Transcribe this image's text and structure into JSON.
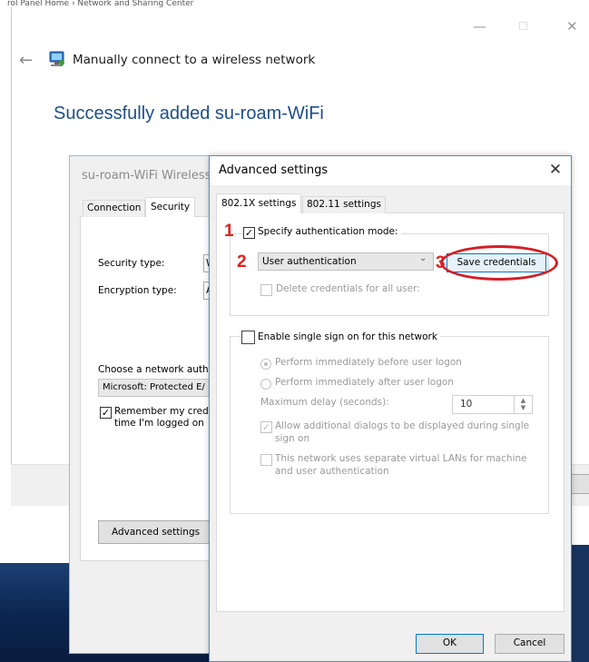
{
  "window": {
    "breadcrumb": "rol Panel Home  ›  Network and Sharing Center",
    "minimize_glyph": "—",
    "maximize_glyph": "☐",
    "close_glyph": "✕"
  },
  "wizard": {
    "title": "Manually connect to a wireless network",
    "success_heading": "Successfully added su-roam-WiFi"
  },
  "properties": {
    "title": "su-roam-WiFi Wireless",
    "tabs": [
      "Connection",
      "Security"
    ],
    "security_type_label": "Security type:",
    "security_type_value": "W",
    "encryption_type_label": "Encryption type:",
    "encryption_type_value": "A",
    "auth_method_label": "Choose a network auth",
    "auth_method_value": "Microsoft: Protected E/",
    "remember_label": "Remember my cred time I'm logged on",
    "remember_checked": true,
    "advanced_button": "Advanced settings"
  },
  "advanced": {
    "title": "Advanced settings",
    "close_glyph": "✕",
    "tabs": [
      "802.1X settings",
      "802.11 settings"
    ],
    "specify_auth_label": "Specify authentication mode:",
    "specify_auth_checked": true,
    "auth_mode_value": "User authentication",
    "save_credentials_button": "Save credentials",
    "delete_credentials_label": "Delete credentials for all user:",
    "sso_label": "Enable single sign on for this network",
    "sso_checked": false,
    "radio_before": "Perform immediately before user logon",
    "radio_after": "Perform immediately after user logon",
    "delay_label": "Maximum delay (seconds):",
    "delay_value": "10",
    "allow_dialogs_label": "Allow additional dialogs to be displayed during single sign on",
    "vlan_label": "This network uses separate virtual LANs for machine and user authentication",
    "ok_button": "OK",
    "cancel_button": "Cancel"
  },
  "annotations": {
    "step1": "1",
    "step2": "2",
    "step3": "3",
    "color": "#e2231a"
  },
  "icons": {
    "back": "back-arrow-icon",
    "network": "network-adapter-icon",
    "dropdown": "chevron-down-icon",
    "check": "✓"
  }
}
